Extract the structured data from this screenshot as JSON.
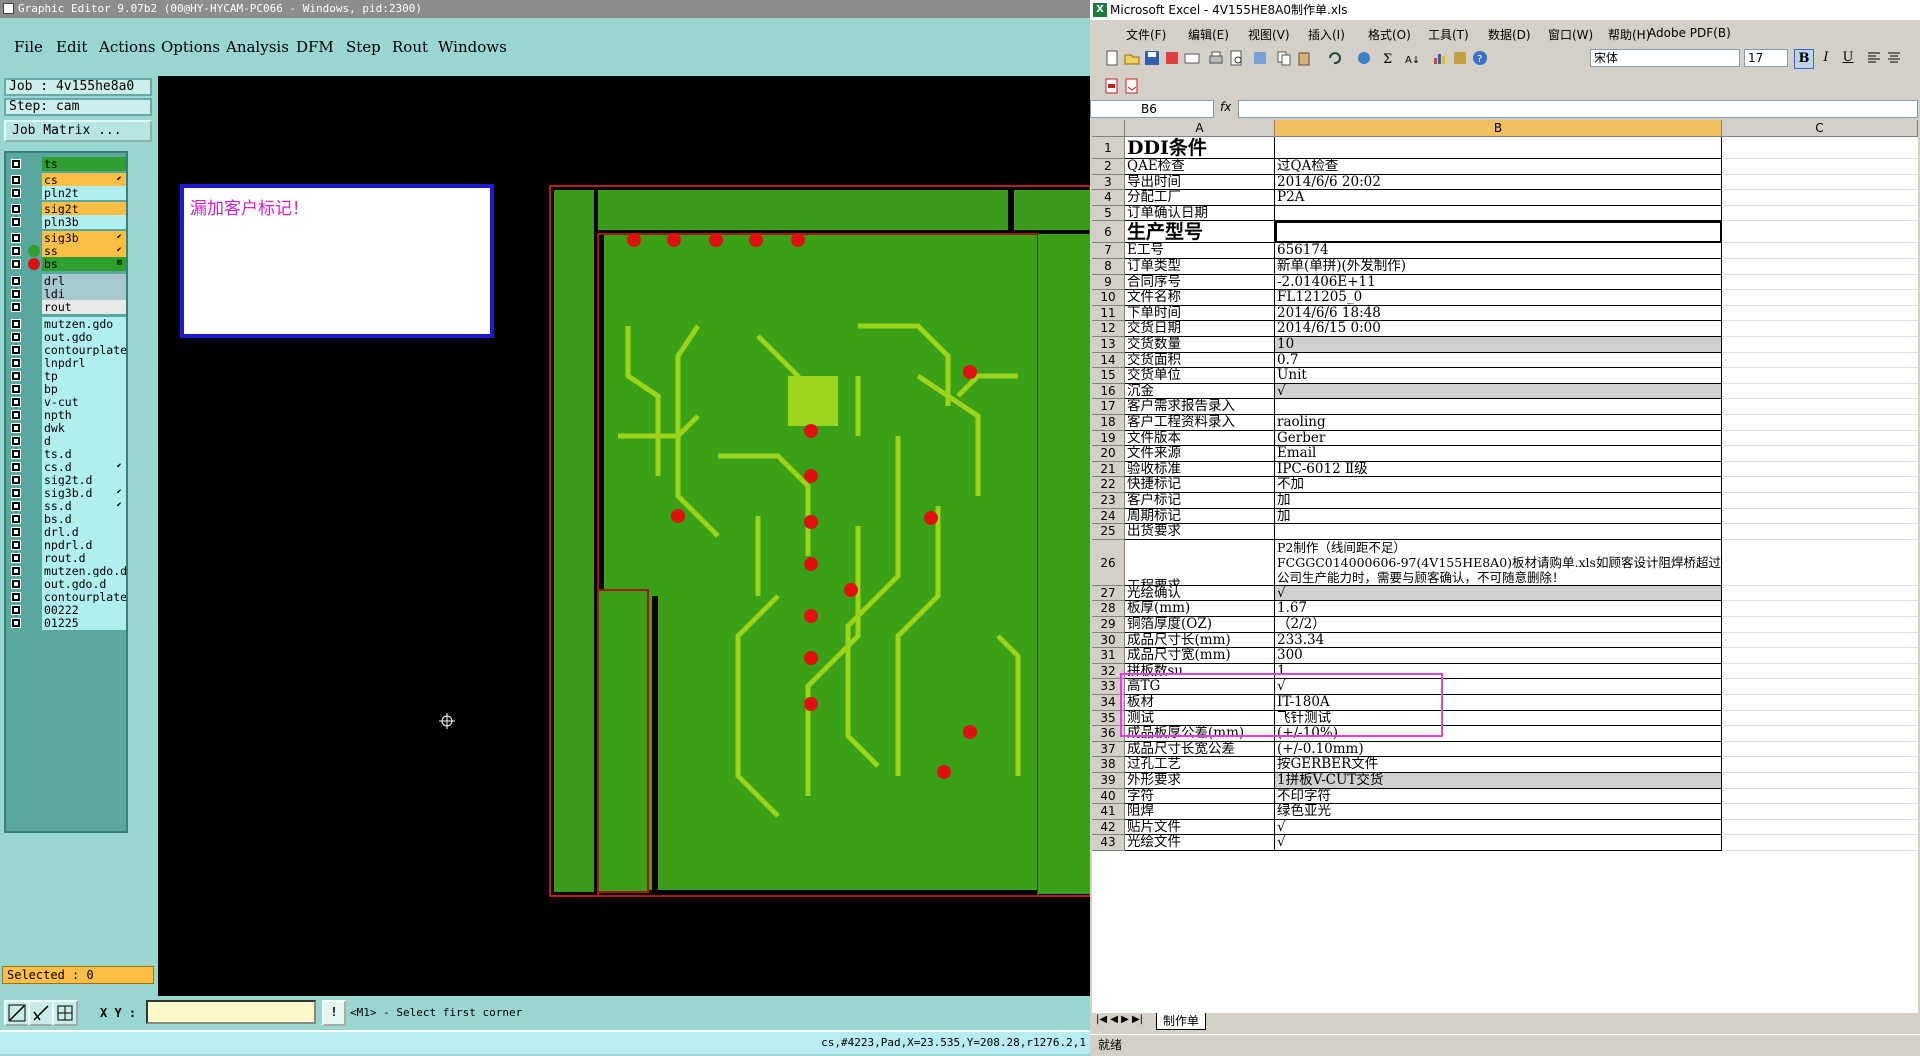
{
  "ge": {
    "title": "Graphic Editor 9.07b2 (00@HY-HYCAM-PC066 - Windows, pid:2300)",
    "menu": [
      "File",
      "Edit",
      "Actions",
      "Options",
      "Analysis",
      "DFM",
      "Step",
      "Rout",
      "Windows"
    ],
    "job": "Job : 4v155he8a0",
    "step": "Step: cam",
    "job_matrix_label": "Job Matrix ...",
    "layers": [
      {
        "name": "ts",
        "color": "#2fa02f",
        "arrow": ""
      },
      {
        "name": "cs",
        "color": "#ffbf46",
        "arrow": "⬋"
      },
      {
        "name": "pln2t",
        "color": "#b0eef0",
        "arrow": ""
      },
      {
        "name": "sig2t",
        "color": "#ffbf46",
        "arrow": ""
      },
      {
        "name": "pln3b",
        "color": "#b0eef0",
        "arrow": ""
      },
      {
        "name": "sig3b",
        "color": "#ffbf46",
        "arrow": "⬋"
      },
      {
        "name": "ss",
        "color": "#ffbf46",
        "arrow": "⬋"
      },
      {
        "name": "bs",
        "color": "#2fa02f",
        "arrow": "⊠"
      },
      {
        "name": "drl",
        "color": "#a8c8d0",
        "arrow": ""
      },
      {
        "name": "ldi",
        "color": "#a8c8d0",
        "arrow": ""
      },
      {
        "name": "rout",
        "color": "#e8e8e8",
        "arrow": ""
      },
      {
        "name": "mutzen.gdo",
        "color": "#b0eef0",
        "arrow": ""
      },
      {
        "name": "out.gdo",
        "color": "#b0eef0",
        "arrow": ""
      },
      {
        "name": "contourplate",
        "color": "#b0eef0",
        "arrow": ""
      },
      {
        "name": "lnpdrl",
        "color": "#b0eef0",
        "arrow": ""
      },
      {
        "name": "tp",
        "color": "#b0eef0",
        "arrow": ""
      },
      {
        "name": "bp",
        "color": "#b0eef0",
        "arrow": ""
      },
      {
        "name": "v-cut",
        "color": "#b0eef0",
        "arrow": ""
      },
      {
        "name": "npth",
        "color": "#b0eef0",
        "arrow": ""
      },
      {
        "name": "dwk",
        "color": "#b0eef0",
        "arrow": ""
      },
      {
        "name": "d",
        "color": "#b0eef0",
        "arrow": ""
      },
      {
        "name": "ts.d",
        "color": "#b0eef0",
        "arrow": ""
      },
      {
        "name": "cs.d",
        "color": "#b0eef0",
        "arrow": "⬋"
      },
      {
        "name": "sig2t.d",
        "color": "#b0eef0",
        "arrow": ""
      },
      {
        "name": "sig3b.d",
        "color": "#b0eef0",
        "arrow": "⬋"
      },
      {
        "name": "ss.d",
        "color": "#b0eef0",
        "arrow": "⬋"
      },
      {
        "name": "bs.d",
        "color": "#b0eef0",
        "arrow": ""
      },
      {
        "name": "drl.d",
        "color": "#b0eef0",
        "arrow": ""
      },
      {
        "name": "npdrl.d",
        "color": "#b0eef0",
        "arrow": ""
      },
      {
        "name": "rout.d",
        "color": "#b0eef0",
        "arrow": ""
      },
      {
        "name": "mutzen.gdo.d",
        "color": "#b0eef0",
        "arrow": ""
      },
      {
        "name": "out.gdo.d",
        "color": "#b0eef0",
        "arrow": ""
      },
      {
        "name": "contourplate",
        "color": "#b0eef0",
        "arrow": ""
      },
      {
        "name": "00222",
        "color": "#b0eef0",
        "arrow": ""
      },
      {
        "name": "01225",
        "color": "#b0eef0",
        "arrow": ""
      }
    ],
    "selected": "Selected : 0",
    "message": "漏加客户标记！",
    "xy_label": "X Y :",
    "xy_value": "",
    "prompt_icon": "!",
    "prompt": "<M1> - Select first corner",
    "status": "cs,#4223,Pad,X=23.535,Y=208.28,r1276.2,1"
  },
  "xl": {
    "title": "Microsoft Excel - 4V155HE8A0制作单.xls",
    "menu": [
      "文件(F)",
      "编辑(E)",
      "视图(V)",
      "插入(I)",
      "格式(O)",
      "工具(T)",
      "数据(D)",
      "窗口(W)",
      "帮助(H)",
      "Adobe PDF(B)"
    ],
    "font": "宋体",
    "font_size": "17",
    "bold": "B",
    "italic": "I",
    "underline": "U",
    "cell_ref": "B6",
    "fx": "fx",
    "formula": "",
    "columns": [
      "A",
      "B",
      "C"
    ],
    "rows": [
      {
        "n": "1",
        "a": "DDI条件",
        "b": "",
        "big": true
      },
      {
        "n": "2",
        "a": "QAE检查",
        "b": "过QA检查"
      },
      {
        "n": "3",
        "a": "导出时间",
        "b": "2014/6/6 20:02"
      },
      {
        "n": "4",
        "a": "分配工厂",
        "b": "P2A"
      },
      {
        "n": "5",
        "a": "订单确认日期",
        "b": ""
      },
      {
        "n": "6",
        "a": "生产型号",
        "b": "",
        "big": true
      },
      {
        "n": "7",
        "a": "E工号",
        "b": "656174"
      },
      {
        "n": "8",
        "a": "订单类型",
        "b": "新单(单拼)(外发制作)"
      },
      {
        "n": "9",
        "a": "合同序号",
        "b": "-2.01406E+11"
      },
      {
        "n": "10",
        "a": "文件名称",
        "b": "FL121205_0"
      },
      {
        "n": "11",
        "a": "下单时间",
        "b": "2014/6/6 18:48"
      },
      {
        "n": "12",
        "a": "交货日期",
        "b": "2014/6/15 0:00"
      },
      {
        "n": "13",
        "a": "交货数量",
        "b": "10",
        "gray": true
      },
      {
        "n": "14",
        "a": "交货面积",
        "b": "0.7"
      },
      {
        "n": "15",
        "a": "交货单位",
        "b": "Unit"
      },
      {
        "n": "16",
        "a": "沉金",
        "b": "√",
        "gray": true
      },
      {
        "n": "17",
        "a": "客户需求报告录入",
        "b": ""
      },
      {
        "n": "18",
        "a": "客户工程资料录入",
        "b": "raoling"
      },
      {
        "n": "19",
        "a": "文件版本",
        "b": "Gerber"
      },
      {
        "n": "20",
        "a": "文件来源",
        "b": "Email"
      },
      {
        "n": "21",
        "a": "验收标准",
        "b": "IPC-6012 Ⅱ级"
      },
      {
        "n": "22",
        "a": "快捷标记",
        "b": "不加"
      },
      {
        "n": "23",
        "a": "客户标记",
        "b": "加"
      },
      {
        "n": "24",
        "a": "周期标记",
        "b": "加"
      },
      {
        "n": "25",
        "a": "出货要求",
        "b": ""
      },
      {
        "n": "26",
        "a": "工程要求",
        "b": "P2制作（线间距不足）\nFCGGC014000606-97(4V155HE8A0)板材请购单.xls如顾客设计阻焊桥超过公司生产能力时，需要与顾客确认，不可随意删除！",
        "tall": true
      },
      {
        "n": "27",
        "a": "光绘确认",
        "b": "√",
        "gray": true
      },
      {
        "n": "28",
        "a": "板厚(mm)",
        "b": "1.67"
      },
      {
        "n": "29",
        "a": "铜箔厚度(OZ)",
        "b": "（2/2）"
      },
      {
        "n": "30",
        "a": "成品尺寸长(mm)",
        "b": "233.34"
      },
      {
        "n": "31",
        "a": "成品尺寸宽(mm)",
        "b": "300"
      },
      {
        "n": "32",
        "a": "拼板数su",
        "b": "1"
      },
      {
        "n": "33",
        "a": "高TG",
        "b": "√"
      },
      {
        "n": "34",
        "a": "板材",
        "b": "IT-180A"
      },
      {
        "n": "35",
        "a": "测试",
        "b": "飞针测试"
      },
      {
        "n": "36",
        "a": "成品板厚公差(mm)",
        "b": "(+/-10%)"
      },
      {
        "n": "37",
        "a": "成品尺寸长宽公差",
        "b": "(+/-0.10mm)"
      },
      {
        "n": "38",
        "a": "过孔工艺",
        "b": "按GERBER文件"
      },
      {
        "n": "39",
        "a": "外形要求",
        "b": "1拼板V-CUT交货",
        "gray": true
      },
      {
        "n": "40",
        "a": "字符",
        "b": "不印字符"
      },
      {
        "n": "41",
        "a": "阻焊",
        "b": "绿色亚光"
      },
      {
        "n": "42",
        "a": "贴片文件",
        "b": "√"
      },
      {
        "n": "43",
        "a": "光绘文件",
        "b": "√"
      }
    ],
    "sheet_tab": "制作单",
    "status": "就绪"
  }
}
